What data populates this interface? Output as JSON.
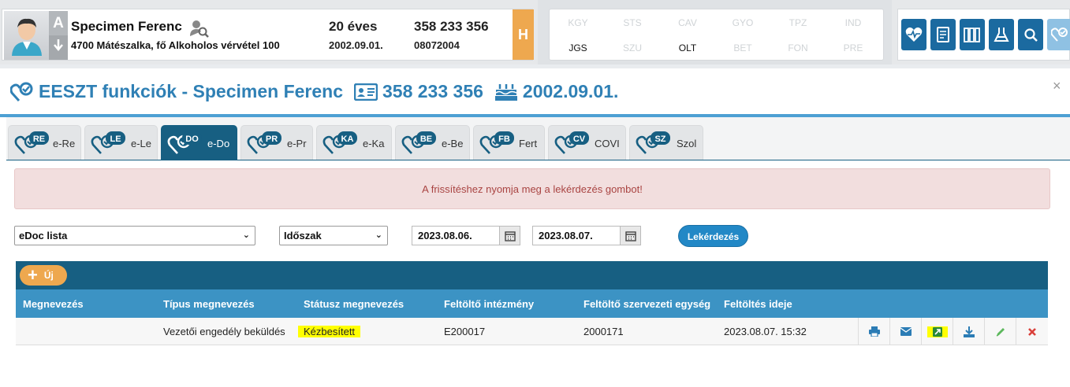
{
  "patient": {
    "avatar_letter": "A",
    "name": "Specimen Ferenc",
    "address": "4700 Mátészalka, fő Alkoholos vérvétel 100",
    "age": "20 éves",
    "dob": "2002.09.01.",
    "taj": "358 233 356",
    "id2": "08072004",
    "h_label": "H"
  },
  "flags": [
    {
      "code": "KGY",
      "on": false
    },
    {
      "code": "STS",
      "on": false
    },
    {
      "code": "CAV",
      "on": false
    },
    {
      "code": "GYO",
      "on": false
    },
    {
      "code": "TPZ",
      "on": false
    },
    {
      "code": "IND",
      "on": false
    },
    {
      "code": "JGS",
      "on": true
    },
    {
      "code": "SZU",
      "on": false
    },
    {
      "code": "OLT",
      "on": true
    },
    {
      "code": "BET",
      "on": false
    },
    {
      "code": "FON",
      "on": false
    },
    {
      "code": "PRE",
      "on": false
    }
  ],
  "toolbar_icons": [
    "heart-pulse-icon",
    "document-icon",
    "books-icon",
    "flask-icon",
    "search-icon",
    "eeszt-icon"
  ],
  "dialog": {
    "title": "EESZT funkciók - Specimen Ferenc",
    "taj": "358 233 356",
    "dob": "2002.09.01.",
    "close": "×"
  },
  "tabs": [
    {
      "code": "RE",
      "label": "e-Re",
      "active": false
    },
    {
      "code": "LE",
      "label": "e-Le",
      "active": false
    },
    {
      "code": "DO",
      "label": "e-Do",
      "active": true
    },
    {
      "code": "PR",
      "label": "e-Pr",
      "active": false
    },
    {
      "code": "KA",
      "label": "e-Ka",
      "active": false
    },
    {
      "code": "BE",
      "label": "e-Be",
      "active": false
    },
    {
      "code": "FB",
      "label": "Fert",
      "active": false
    },
    {
      "code": "CV",
      "label": "COVI",
      "active": false
    },
    {
      "code": "SZ",
      "label": "Szol",
      "active": false
    }
  ],
  "alert": "A frissítéshez nyomja meg a lekérdezés gombot!",
  "filters": {
    "list_select": "eDoc lista",
    "period_select": "Időszak",
    "date_from": "2023.08.06.",
    "date_to": "2023.08.07.",
    "query_button": "Lekérdezés"
  },
  "table": {
    "new_button": "Új",
    "columns": [
      "Megnevezés",
      "Típus megnevezés",
      "Státusz megnevezés",
      "Feltöltő intézmény",
      "Feltöltő szervezeti egység",
      "Feltöltés ideje"
    ],
    "rows": [
      {
        "name": "",
        "type": "Vezetői engedély beküldés",
        "status": "Kézbesített",
        "institution": "E200017",
        "unit": "2000171",
        "uploaded": "2023.08.07. 15:32"
      }
    ],
    "row_actions": [
      "print-icon",
      "envelope-icon",
      "open-external-icon",
      "download-icon",
      "edit-icon",
      "delete-icon"
    ]
  },
  "colors": {
    "primary_dark": "#175f82",
    "primary": "#3c93c4",
    "accent_orange": "#eea84f",
    "title_blue": "#2f80b5",
    "highlight": "#ffff00",
    "alert_text": "#a94442"
  }
}
